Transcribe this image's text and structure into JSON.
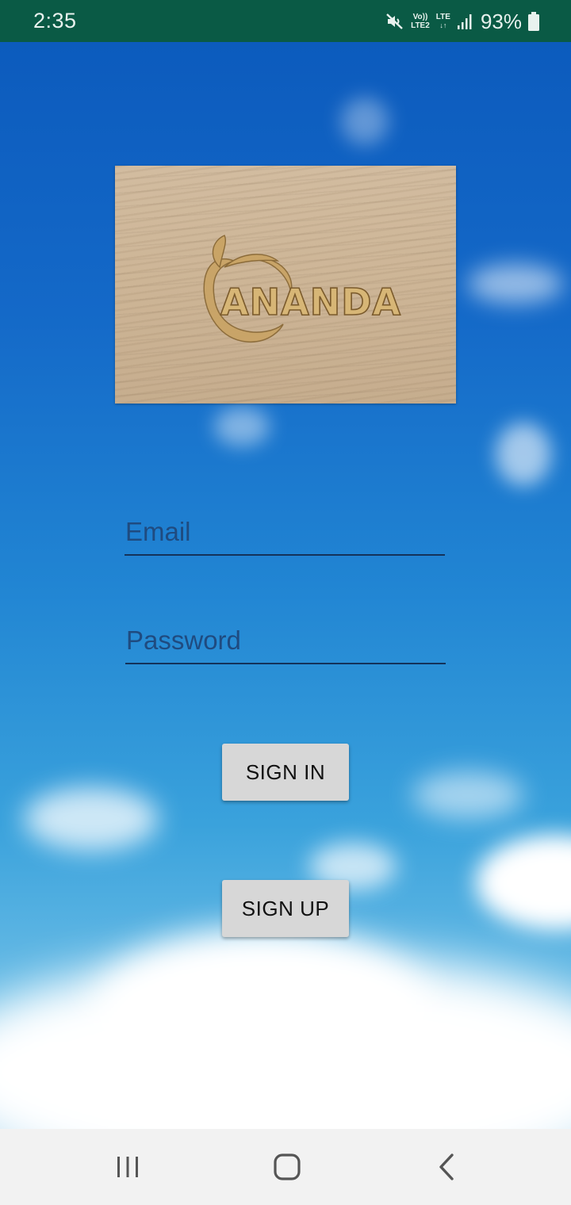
{
  "status_bar": {
    "time": "2:35",
    "net_volte": "Vo))",
    "net_lte2": "LTE2",
    "net_lte": "LTE",
    "battery_percent": "93%",
    "icons": [
      "mute-icon",
      "volte-icon",
      "lte-data-icon",
      "signal-icon",
      "battery-icon"
    ],
    "background_color": "#0a5a45"
  },
  "logo": {
    "text": "ANANDA",
    "icons": [
      "leaf-icon"
    ],
    "style": "engraved wood"
  },
  "form": {
    "email_placeholder": "Email",
    "password_placeholder": "Password",
    "email_value": "",
    "password_value": ""
  },
  "buttons": {
    "sign_in": "SIGN IN",
    "sign_up": "SIGN UP"
  },
  "nav_bar": {
    "icons": [
      "recents-icon",
      "home-icon",
      "back-icon"
    ]
  },
  "colors": {
    "sky_top": "#0c5bbd",
    "sky_bottom": "#a8d6ef",
    "input_line": "#14325a",
    "button_bg": "#d7d7d7"
  }
}
